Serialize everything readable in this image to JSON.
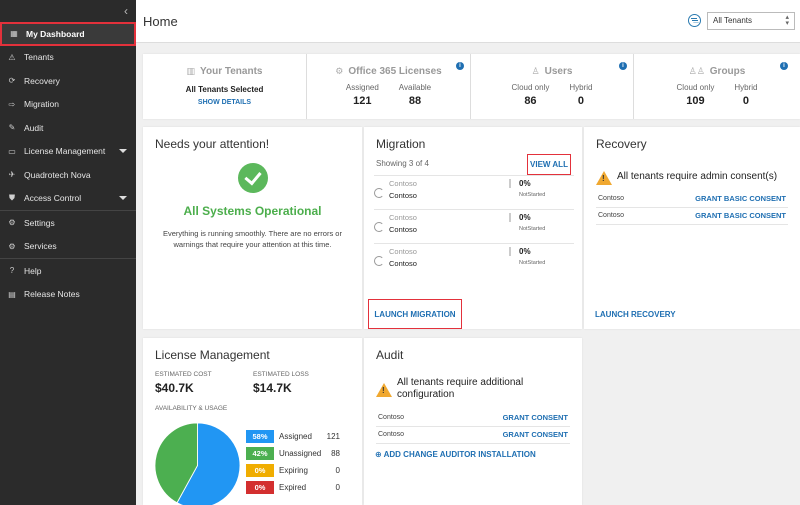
{
  "sidebar": {
    "items": [
      {
        "label": "My Dashboard",
        "icon": "dashboard-icon",
        "glyph": "▦"
      },
      {
        "label": "Tenants",
        "icon": "tenants-icon",
        "glyph": "⚠"
      },
      {
        "label": "Recovery",
        "icon": "recovery-icon",
        "glyph": "⟳"
      },
      {
        "label": "Migration",
        "icon": "migration-icon",
        "glyph": "⇨"
      },
      {
        "label": "Audit",
        "icon": "audit-icon",
        "glyph": "✎"
      },
      {
        "label": "License Management",
        "icon": "license-icon",
        "glyph": "▭"
      },
      {
        "label": "Quadrotech Nova",
        "icon": "nova-icon",
        "glyph": "✈"
      },
      {
        "label": "Access Control",
        "icon": "access-control-icon",
        "glyph": "⛊"
      },
      {
        "label": "Settings",
        "icon": "settings-icon",
        "glyph": "⚙"
      },
      {
        "label": "Services",
        "icon": "services-icon",
        "glyph": "⚙"
      },
      {
        "label": "Help",
        "icon": "help-icon",
        "glyph": "?"
      },
      {
        "label": "Release Notes",
        "icon": "release-notes-icon",
        "glyph": "▤"
      }
    ]
  },
  "header": {
    "title": "Home",
    "tenant_filter": "All Tenants"
  },
  "summary": {
    "tenants": {
      "title": "Your Tenants",
      "selected": "All Tenants Selected",
      "show_details": "SHOW DETAILS"
    },
    "licenses": {
      "title": "Office 365 Licenses",
      "assigned_label": "Assigned",
      "assigned": "121",
      "available_label": "Available",
      "available": "88"
    },
    "users": {
      "title": "Users",
      "cloud_label": "Cloud only",
      "cloud": "86",
      "hybrid_label": "Hybrid",
      "hybrid": "0"
    },
    "groups": {
      "title": "Groups",
      "cloud_label": "Cloud only",
      "cloud": "109",
      "hybrid_label": "Hybrid",
      "hybrid": "0"
    }
  },
  "attention": {
    "title": "Needs your attention!",
    "status": "All Systems Operational",
    "message": "Everything is running smoothly. There are no errors or warnings that require your attention at this time."
  },
  "migration": {
    "title": "Migration",
    "showing": "Showing 3 of 4",
    "view_all": "VIEW ALL",
    "rows": [
      {
        "source": "Contoso",
        "target": "Contoso",
        "percent": "0%",
        "status": "NotStarted"
      },
      {
        "source": "Contoso",
        "target": "Contoso",
        "percent": "0%",
        "status": "NotStarted"
      },
      {
        "source": "Contoso",
        "target": "Contoso",
        "percent": "0%",
        "status": "NotStarted"
      }
    ],
    "launch": "LAUNCH MIGRATION"
  },
  "recovery": {
    "title": "Recovery",
    "warning": "All tenants require admin consent(s)",
    "rows": [
      {
        "tenant": "Contoso",
        "action": "GRANT BASIC CONSENT"
      },
      {
        "tenant": "Contoso",
        "action": "GRANT BASIC CONSENT"
      }
    ],
    "launch": "LAUNCH RECOVERY"
  },
  "license": {
    "title": "License Management",
    "est_cost_label": "ESTIMATED COST",
    "est_cost": "$40.7K",
    "est_loss_label": "ESTIMATED LOSS",
    "est_loss": "$14.7K",
    "availability_label": "AVAILABILITY & USAGE",
    "legend": [
      {
        "percent": "58%",
        "name": "Assigned",
        "count": "121",
        "color": "#2196f3"
      },
      {
        "percent": "42%",
        "name": "Unassigned",
        "count": "88",
        "color": "#4caf50"
      },
      {
        "percent": "0%",
        "name": "Expiring",
        "count": "0",
        "color": "#f0ad00"
      },
      {
        "percent": "0%",
        "name": "Expired",
        "count": "0",
        "color": "#d32f2f"
      }
    ],
    "pie_values": [
      58,
      42
    ]
  },
  "audit": {
    "title": "Audit",
    "warning": "All tenants require additional configuration",
    "rows": [
      {
        "tenant": "Contoso",
        "action": "GRANT CONSENT"
      },
      {
        "tenant": "Contoso",
        "action": "GRANT CONSENT"
      }
    ],
    "add_link": "⊕ ADD CHANGE AUDITOR INSTALLATION"
  }
}
